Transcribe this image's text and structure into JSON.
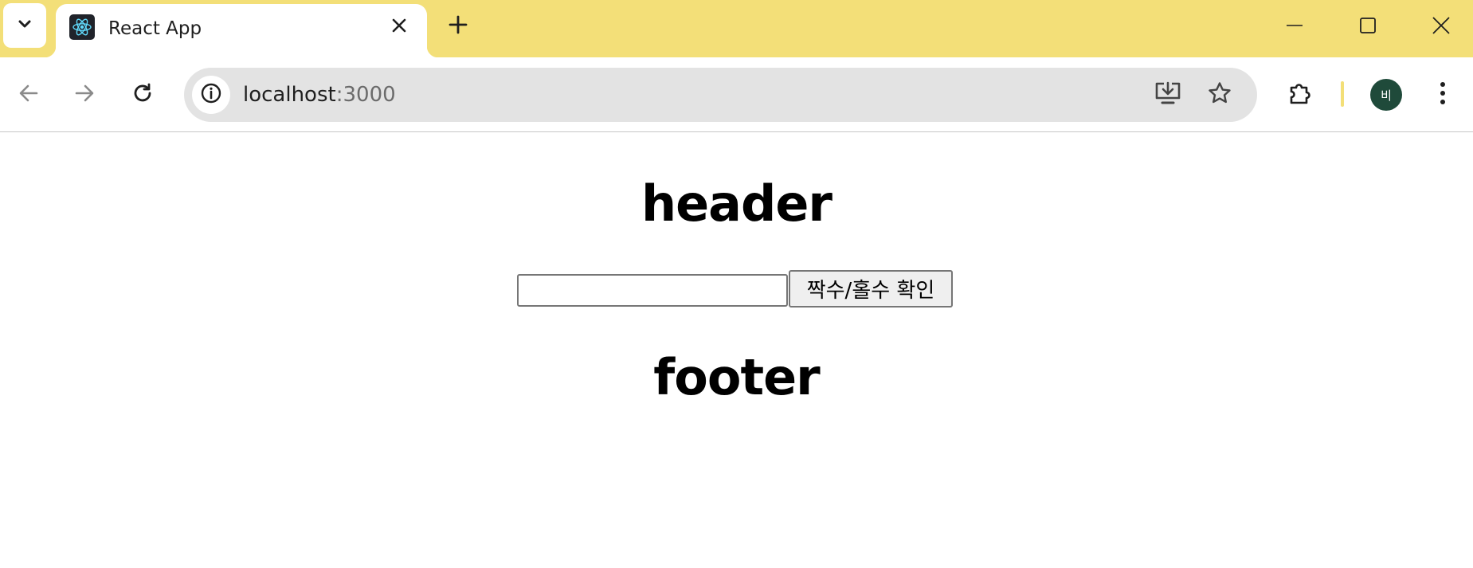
{
  "browser": {
    "tab": {
      "title": "React App",
      "favicon": "react-logo"
    },
    "icons": {
      "tab_search": "chevron-down-icon",
      "tab_close": "close-icon",
      "new_tab": "plus-icon",
      "minimize": "minimize-icon",
      "maximize": "maximize-icon",
      "close_window": "close-icon",
      "back": "arrow-left-icon",
      "forward": "arrow-right-icon",
      "reload": "reload-icon",
      "site_info": "info-icon",
      "install_app": "install-icon",
      "bookmark": "star-icon",
      "extensions": "puzzle-icon",
      "menu": "kebab-menu-icon"
    },
    "address_bar": {
      "host": "localhost",
      "port": ":3000"
    },
    "profile": {
      "initial": "비",
      "color": "#1f4a3a"
    },
    "theme": {
      "frame_color": "#f3df78"
    }
  },
  "page": {
    "header_text": "header",
    "input_value": "",
    "button_label": "짝수/홀수 확인",
    "footer_text": "footer"
  }
}
